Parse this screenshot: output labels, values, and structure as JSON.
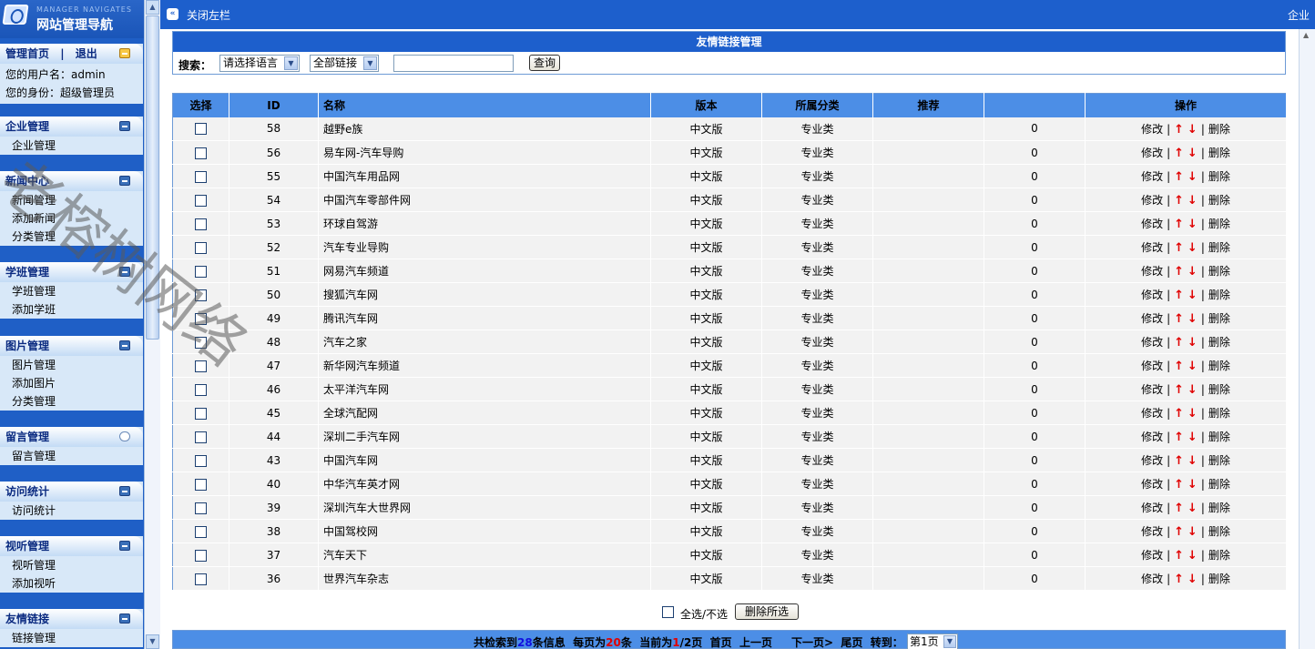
{
  "app": {
    "logo_sub": "MANAGER NAVIGATES",
    "logo_title": "网站管理导航"
  },
  "sidebar": {
    "top": {
      "home": "管理首页",
      "sep": "|",
      "logout": "退出",
      "user_label": "您的用户名：admin",
      "role_label": "您的身份：超级管理员"
    },
    "groups": [
      {
        "title": "企业管理",
        "icon": "collapse-icon",
        "items": [
          "企业管理"
        ]
      },
      {
        "title": "新闻中心",
        "icon": "collapse-icon",
        "items": [
          "新闻管理",
          "添加新闻",
          "分类管理"
        ]
      },
      {
        "title": "学班管理",
        "icon": "collapse-icon",
        "items": [
          "学班管理",
          "添加学班"
        ]
      },
      {
        "title": "图片管理",
        "icon": "collapse-icon",
        "items": [
          "图片管理",
          "添加图片",
          "分类管理"
        ]
      },
      {
        "title": "留言管理",
        "icon": "chat-bubble-icon",
        "items": [
          "留言管理"
        ]
      },
      {
        "title": "访问统计",
        "icon": "collapse-icon",
        "items": [
          "访问统计"
        ]
      },
      {
        "title": "视听管理",
        "icon": "collapse-icon",
        "items": [
          "视听管理",
          "添加视听"
        ]
      },
      {
        "title": "友情链接",
        "icon": "collapse-icon",
        "items": [
          "链接管理"
        ]
      }
    ]
  },
  "topbar": {
    "toggle_label": "关闭左栏",
    "corner_label": "企业"
  },
  "search": {
    "panel_title": "友情链接管理",
    "label": "搜索：",
    "language_select": "请选择语言",
    "category_select": "全部链接",
    "keyword_value": "",
    "query_button": "查询"
  },
  "table": {
    "headers": [
      "选择",
      "ID",
      "名称",
      "版本",
      "所属分类",
      "推荐",
      "",
      "操作"
    ],
    "rows": [
      {
        "id": "58",
        "name": "越野e族",
        "version": "中文版",
        "category": "专业类",
        "recommend": "",
        "count": "0"
      },
      {
        "id": "56",
        "name": "易车网-汽车导购",
        "version": "中文版",
        "category": "专业类",
        "recommend": "",
        "count": "0"
      },
      {
        "id": "55",
        "name": "中国汽车用品网",
        "version": "中文版",
        "category": "专业类",
        "recommend": "",
        "count": "0"
      },
      {
        "id": "54",
        "name": "中国汽车零部件网",
        "version": "中文版",
        "category": "专业类",
        "recommend": "",
        "count": "0"
      },
      {
        "id": "53",
        "name": "环球自驾游",
        "version": "中文版",
        "category": "专业类",
        "recommend": "",
        "count": "0"
      },
      {
        "id": "52",
        "name": "汽车专业导购",
        "version": "中文版",
        "category": "专业类",
        "recommend": "",
        "count": "0"
      },
      {
        "id": "51",
        "name": "网易汽车频道",
        "version": "中文版",
        "category": "专业类",
        "recommend": "",
        "count": "0"
      },
      {
        "id": "50",
        "name": "搜狐汽车网",
        "version": "中文版",
        "category": "专业类",
        "recommend": "",
        "count": "0"
      },
      {
        "id": "49",
        "name": "腾讯汽车网",
        "version": "中文版",
        "category": "专业类",
        "recommend": "",
        "count": "0"
      },
      {
        "id": "48",
        "name": "汽车之家",
        "version": "中文版",
        "category": "专业类",
        "recommend": "",
        "count": "0"
      },
      {
        "id": "47",
        "name": "新华网汽车频道",
        "version": "中文版",
        "category": "专业类",
        "recommend": "",
        "count": "0"
      },
      {
        "id": "46",
        "name": "太平洋汽车网",
        "version": "中文版",
        "category": "专业类",
        "recommend": "",
        "count": "0"
      },
      {
        "id": "45",
        "name": "全球汽配网",
        "version": "中文版",
        "category": "专业类",
        "recommend": "",
        "count": "0"
      },
      {
        "id": "44",
        "name": "深圳二手汽车网",
        "version": "中文版",
        "category": "专业类",
        "recommend": "",
        "count": "0"
      },
      {
        "id": "43",
        "name": "中国汽车网",
        "version": "中文版",
        "category": "专业类",
        "recommend": "",
        "count": "0"
      },
      {
        "id": "40",
        "name": "中华汽车英才网",
        "version": "中文版",
        "category": "专业类",
        "recommend": "",
        "count": "0"
      },
      {
        "id": "39",
        "name": "深圳汽车大世界网",
        "version": "中文版",
        "category": "专业类",
        "recommend": "",
        "count": "0"
      },
      {
        "id": "38",
        "name": "中国驾校网",
        "version": "中文版",
        "category": "专业类",
        "recommend": "",
        "count": "0"
      },
      {
        "id": "37",
        "name": "汽车天下",
        "version": "中文版",
        "category": "专业类",
        "recommend": "",
        "count": "0"
      },
      {
        "id": "36",
        "name": "世界汽车杂志",
        "version": "中文版",
        "category": "专业类",
        "recommend": "",
        "count": "0"
      }
    ],
    "ops": {
      "edit": "修改",
      "sep": "|",
      "up": "↑",
      "down": "↓",
      "delete": "删除"
    }
  },
  "bulk": {
    "select_all_label": "全选/不选",
    "delete_selected_button": "删除所选"
  },
  "pager": {
    "t1": "共检索到",
    "total": "28",
    "t2": "条信息",
    "t3": "每页为",
    "per_page": "20",
    "t4": "条",
    "t5": "当前为",
    "current": "1",
    "t6": "/2页",
    "first": "首页",
    "prev": "上一页",
    "next": "下一页>",
    "last": "尾页",
    "jump_label": "转到：",
    "page_select": "第1页"
  },
  "watermark": "老榕树网络",
  "colors": {
    "accent_blue": "#1d5fcc",
    "header_blue": "#4c8ee6",
    "arrow_red": "#e00000",
    "pager_blue": "#1010e0"
  }
}
